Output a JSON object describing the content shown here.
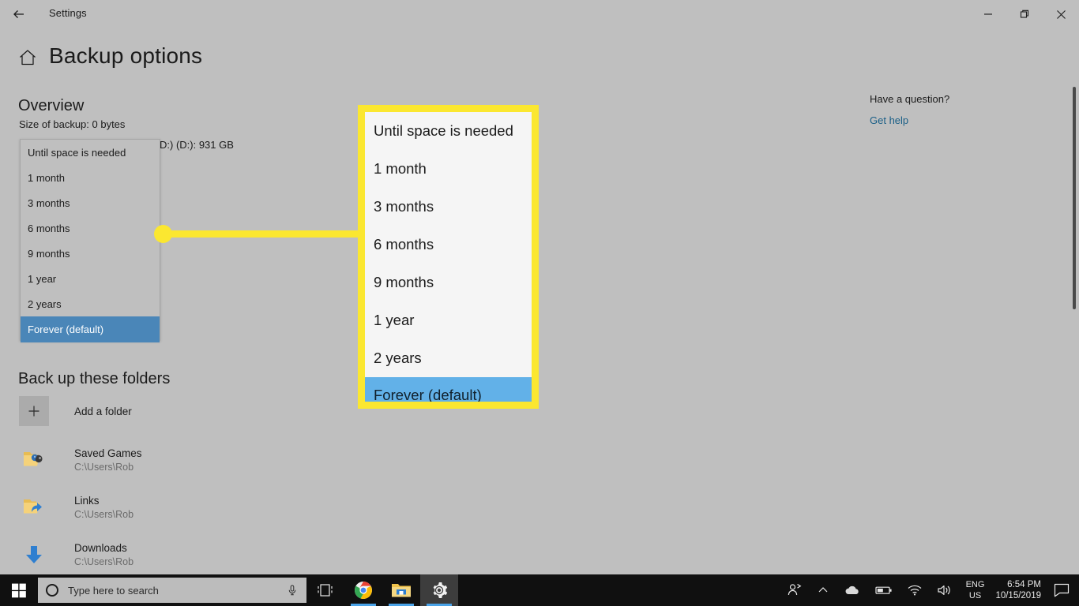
{
  "window": {
    "app_title": "Settings",
    "back_icon": "back-arrow-icon",
    "minimize_label": "–",
    "maximize_label": "❐",
    "close_label": "✕"
  },
  "header": {
    "home_icon": "home-icon",
    "page_title": "Backup options"
  },
  "overview": {
    "heading": "Overview",
    "backup_size": "Size of backup: 0 bytes",
    "drive_label": "D:) (D:): 931 GB"
  },
  "retention_dropdown": {
    "name": "keep-my-backups-dropdown",
    "options": [
      "Until space is needed",
      "1 month",
      "3 months",
      "6 months",
      "9 months",
      "1 year",
      "2 years",
      "Forever (default)"
    ],
    "selected": "Forever (default)",
    "selected_index": 7
  },
  "callout": {
    "name": "zoom-callout",
    "border_color": "#fbe730",
    "highlight_color": "#62b1e8",
    "options": [
      "Until space is needed",
      "1 month",
      "3 months",
      "6 months",
      "9 months",
      "1 year",
      "2 years",
      "Forever (default)"
    ],
    "selected_index": 7
  },
  "folders": {
    "heading": "Back up these folders",
    "add_folder": {
      "label": "Add a folder",
      "icon": "plus-icon"
    },
    "items": [
      {
        "name": "Saved Games",
        "path": "C:\\Users\\Rob",
        "icon": "folder-saved-games-icon"
      },
      {
        "name": "Links",
        "path": "C:\\Users\\Rob",
        "icon": "folder-links-icon"
      },
      {
        "name": "Downloads",
        "path": "C:\\Users\\Rob",
        "icon": "downloads-arrow-icon"
      }
    ]
  },
  "help": {
    "title": "Have a question?",
    "link": "Get help",
    "link_color": "#1a5f87"
  },
  "taskbar": {
    "start_icon": "windows-start-icon",
    "search_placeholder": "Type here to search",
    "mic_icon": "microphone-icon",
    "apps": [
      {
        "icon": "task-view-icon",
        "label": "Task View",
        "active": false
      },
      {
        "icon": "chrome-icon",
        "label": "Google Chrome",
        "active": false
      },
      {
        "icon": "file-explorer-icon",
        "label": "File Explorer",
        "active": false
      },
      {
        "icon": "settings-gear-icon",
        "label": "Settings",
        "active": true
      }
    ],
    "tray": {
      "people_icon": "people-icon",
      "chevron_icon": "show-hidden-icons-chevron",
      "cloud_icon": "onedrive-cloud-icon",
      "battery_icon": "battery-icon",
      "network_icon": "wifi-icon",
      "volume_icon": "speaker-volume-icon",
      "language_top": "ENG",
      "language_bottom": "US",
      "time": "6:54 PM",
      "date": "10/15/2019",
      "action_center_icon": "action-center-icon"
    }
  }
}
